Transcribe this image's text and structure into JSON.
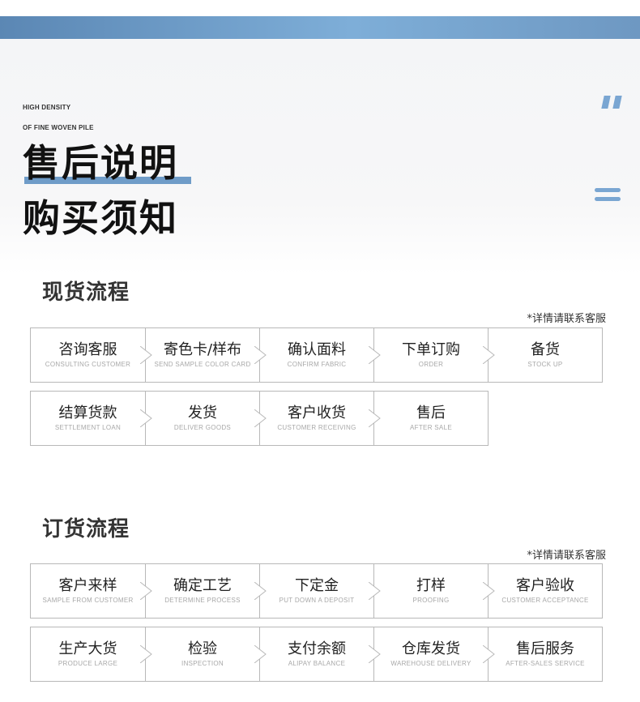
{
  "header": {
    "en_line1": "HIGH DENSITY",
    "en_line2": "OF FINE WOVEN PILE",
    "title1": "售后说明",
    "title2": "购买须知"
  },
  "spot": {
    "title": "现货流程",
    "note": "*详情请联系客服",
    "steps": [
      {
        "cn": "咨询客服",
        "en": "CONSULTING CUSTOMER"
      },
      {
        "cn": "寄色卡/样布",
        "en": "SEND SAMPLE COLOR CARD"
      },
      {
        "cn": "确认面料",
        "en": "CONFIRM FABRIC"
      },
      {
        "cn": "下单订购",
        "en": "ORDER"
      },
      {
        "cn": "备货",
        "en": "STOCK UP"
      },
      {
        "cn": "结算货款",
        "en": "SETTLEMENT LOAN"
      },
      {
        "cn": "发货",
        "en": "DELIVER GOODS"
      },
      {
        "cn": "客户收货",
        "en": "CUSTOMER RECEIVING"
      },
      {
        "cn": "售后",
        "en": "AFTER SALE"
      }
    ]
  },
  "order": {
    "title": "订货流程",
    "note": "*详情请联系客服",
    "steps": [
      {
        "cn": "客户来样",
        "en": "SAMPLE FROM CUSTOMER"
      },
      {
        "cn": "确定工艺",
        "en": "DETERMINE PROCESS"
      },
      {
        "cn": "下定金",
        "en": "PUT DOWN A DEPOSIT"
      },
      {
        "cn": "打样",
        "en": "PROOFING"
      },
      {
        "cn": "客户验收",
        "en": "CUSTOMER ACCEPTANCE"
      },
      {
        "cn": "生产大货",
        "en": "PRODUCE LARGE"
      },
      {
        "cn": "检验",
        "en": "INSPECTION"
      },
      {
        "cn": "支付余额",
        "en": "ALIPAY BALANCE"
      },
      {
        "cn": "仓库发货",
        "en": "WAREHOUSE DELIVERY"
      },
      {
        "cn": "售后服务",
        "en": "AFTER-SALES SERVICE"
      }
    ]
  },
  "icons": {
    "quote": "quote-icon",
    "menu": "menu-icon",
    "arrow": "chevron-right-icon"
  },
  "colors": {
    "accent": "#7aa6d2",
    "topbar": "#6e9cc8",
    "border": "#b8b8b8"
  }
}
